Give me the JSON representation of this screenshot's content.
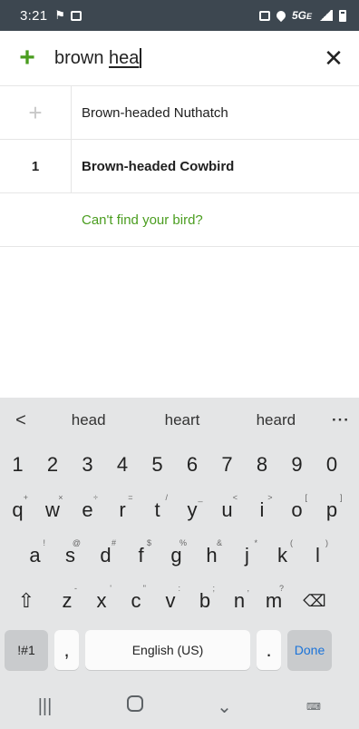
{
  "status_bar": {
    "time": "3:21",
    "network": "5G",
    "network_suffix": "E"
  },
  "search": {
    "value_prefix": "brown ",
    "value_typed": "hea",
    "add_icon": "plus-icon",
    "close_icon": "close-icon"
  },
  "results": [
    {
      "left": "+",
      "name": "Brown-headed Nuthatch",
      "bold": false
    },
    {
      "left": "1",
      "name": "Brown-headed Cowbird",
      "bold": true
    }
  ],
  "cant_find": "Can't find your bird?",
  "keyboard": {
    "suggestions": [
      "head",
      "heart",
      "heard"
    ],
    "numbers": [
      "1",
      "2",
      "3",
      "4",
      "5",
      "6",
      "7",
      "8",
      "9",
      "0"
    ],
    "row1": [
      {
        "k": "q",
        "s": "+"
      },
      {
        "k": "w",
        "s": "×"
      },
      {
        "k": "e",
        "s": "÷"
      },
      {
        "k": "r",
        "s": "="
      },
      {
        "k": "t",
        "s": "/"
      },
      {
        "k": "y",
        "s": "_"
      },
      {
        "k": "u",
        "s": "<"
      },
      {
        "k": "i",
        "s": ">"
      },
      {
        "k": "o",
        "s": "["
      },
      {
        "k": "p",
        "s": "]"
      }
    ],
    "row2": [
      {
        "k": "a",
        "s": "!"
      },
      {
        "k": "s",
        "s": "@"
      },
      {
        "k": "d",
        "s": "#"
      },
      {
        "k": "f",
        "s": "$"
      },
      {
        "k": "g",
        "s": "%"
      },
      {
        "k": "h",
        "s": "&"
      },
      {
        "k": "j",
        "s": "*"
      },
      {
        "k": "k",
        "s": "("
      },
      {
        "k": "l",
        "s": ")"
      }
    ],
    "row3": [
      {
        "k": "z",
        "s": "-"
      },
      {
        "k": "x",
        "s": "'"
      },
      {
        "k": "c",
        "s": "\""
      },
      {
        "k": "v",
        "s": ":"
      },
      {
        "k": "b",
        "s": ";"
      },
      {
        "k": "n",
        "s": ","
      },
      {
        "k": "m",
        "s": "?"
      }
    ],
    "sym_label": "!#1",
    "comma": ",",
    "space_label": "English (US)",
    "period": ".",
    "done_label": "Done"
  },
  "colors": {
    "accent_green": "#4a9d1f",
    "status_bar": "#3d4750",
    "keyboard_bg": "#e4e5e6",
    "done_blue": "#1a73d9"
  }
}
